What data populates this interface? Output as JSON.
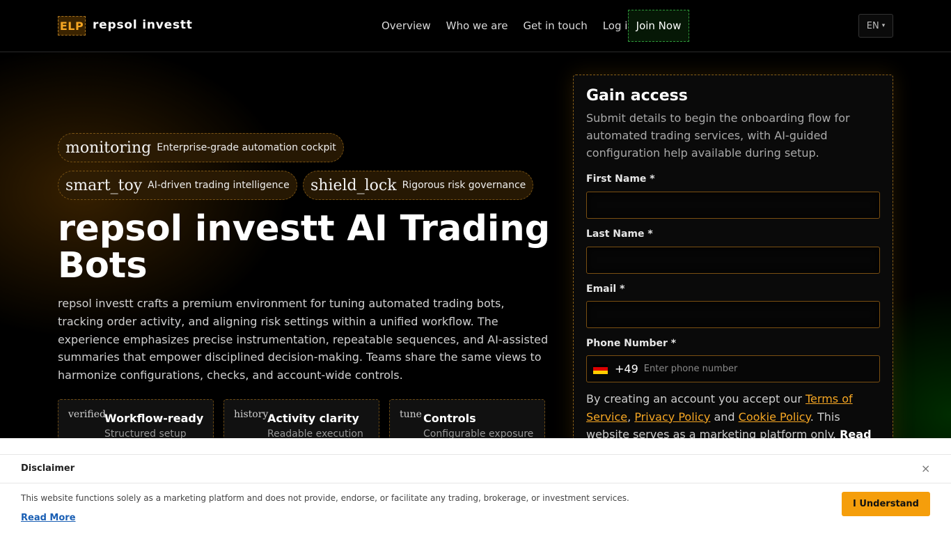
{
  "header": {
    "logo_text": "ELP",
    "brand": "repsol investt",
    "nav": [
      "Overview",
      "Who we are",
      "Get in touch",
      "Log in"
    ],
    "join_label": "Join Now",
    "lang": "EN",
    "lang_caret": "▾"
  },
  "chips": [
    {
      "icon": "monitoring",
      "text": "Enterprise-grade automation cockpit"
    },
    {
      "icon": "smart_toy",
      "text": "AI-driven trading intelligence"
    },
    {
      "icon": "shield_lock",
      "text": "Rigorous risk governance"
    }
  ],
  "hero": {
    "title": "repsol investt AI Trading Bots",
    "description": "repsol investt crafts a premium environment for tuning automated trading bots, tracking order activity, and aligning risk settings within a unified workflow. The experience emphasizes precise instrumentation, repeatable sequences, and AI-assisted summaries that empower disciplined decision-making. Teams share the same views to harmonize configurations, checks, and account-wide controls."
  },
  "cards": [
    {
      "icon": "verified",
      "title": "Workflow-ready",
      "sub": "Structured setup"
    },
    {
      "icon": "history",
      "title": "Activity clarity",
      "sub": "Readable execution"
    },
    {
      "icon": "tune",
      "title": "Controls",
      "sub": "Configurable exposure"
    }
  ],
  "form": {
    "title": "Gain access",
    "description": "Submit details to begin the onboarding flow for automated trading services, with AI-guided configuration help available during setup.",
    "first_name_label": "First Name *",
    "last_name_label": "Last Name *",
    "email_label": "Email *",
    "phone_label": "Phone Number *",
    "dial_code": "+49",
    "phone_placeholder": "Enter phone number",
    "flag_colors": [
      "#000000",
      "#dd0000",
      "#ffce00"
    ],
    "terms_prefix": "By creating an account you accept our ",
    "terms_link": "Terms of Service",
    "terms_sep1": ", ",
    "privacy_link": "Privacy Policy",
    "terms_sep2": " and ",
    "cookie_link": "Cookie Policy",
    "terms_suffix": ". This website serves as a marketing platform only. ",
    "read_more": "Read"
  },
  "disclaimer": {
    "title": "Disclaimer",
    "close": "×",
    "text": "This website functions solely as a marketing platform and does not provide, endorse, or facilitate any trading, brokerage, or investment services.",
    "read_more": "Read More",
    "button": "I Understand"
  },
  "colors": {
    "accent": "#f5a623",
    "join_border": "#2f9a3a",
    "disclaimer_button": "#f59e0b",
    "link_blue": "#1a5fb4"
  }
}
